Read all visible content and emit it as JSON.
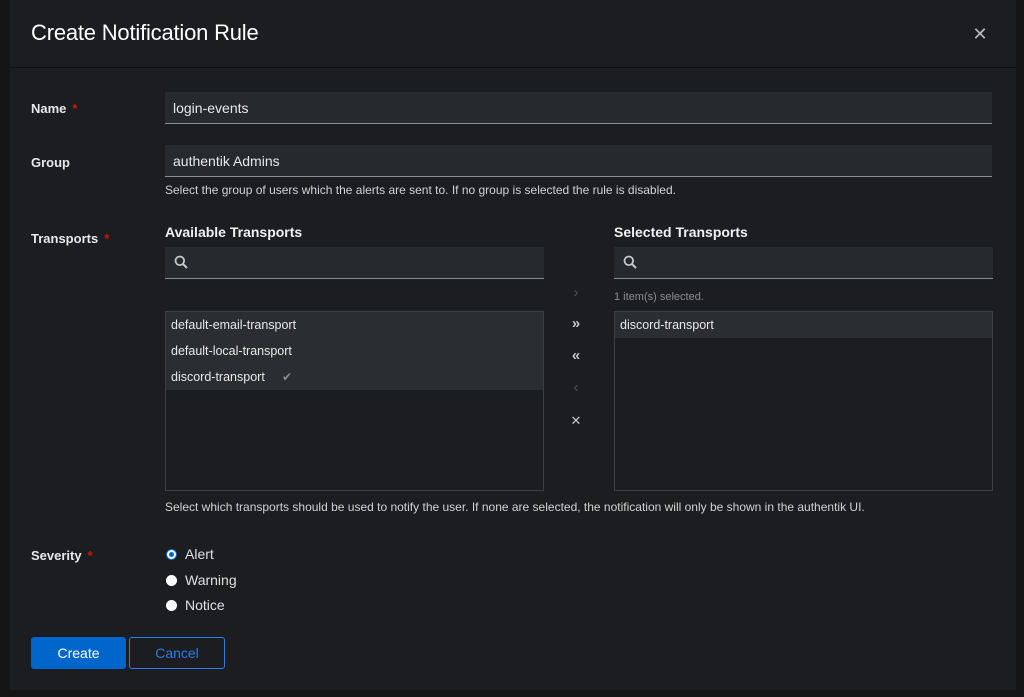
{
  "modal": {
    "title": "Create Notification Rule",
    "close_icon": "close-icon"
  },
  "form": {
    "name": {
      "label": "Name",
      "required_mark": "*",
      "value": "login-events"
    },
    "group": {
      "label": "Group",
      "value": "authentik Admins",
      "helper": "Select the group of users which the alerts are sent to. If no group is selected the rule is disabled."
    },
    "transports": {
      "label": "Transports",
      "required_mark": "*",
      "available": {
        "title": "Available Transports",
        "search_placeholder": "",
        "items": [
          {
            "label": "default-email-transport",
            "selected": false
          },
          {
            "label": "default-local-transport",
            "selected": false
          },
          {
            "label": "discord-transport",
            "selected": true
          }
        ]
      },
      "selected": {
        "title": "Selected Transports",
        "search_placeholder": "",
        "status": "1 item(s) selected.",
        "items": [
          {
            "label": "discord-transport"
          }
        ]
      },
      "controls": {
        "add_selected": "›",
        "add_all": "»",
        "remove_all": "«",
        "remove_selected": "‹",
        "clear": "✕"
      },
      "helper": "Select which transports should be used to notify the user. If none are selected, the notification will only be shown in the authentik UI."
    },
    "severity": {
      "label": "Severity",
      "required_mark": "*",
      "options": [
        {
          "label": "Alert",
          "checked": true
        },
        {
          "label": "Warning",
          "checked": false
        },
        {
          "label": "Notice",
          "checked": false
        }
      ]
    }
  },
  "actions": {
    "create": "Create",
    "cancel": "Cancel"
  },
  "colors": {
    "accent": "#0066cc",
    "required": "#c9190b",
    "background": "#1b1d21"
  }
}
